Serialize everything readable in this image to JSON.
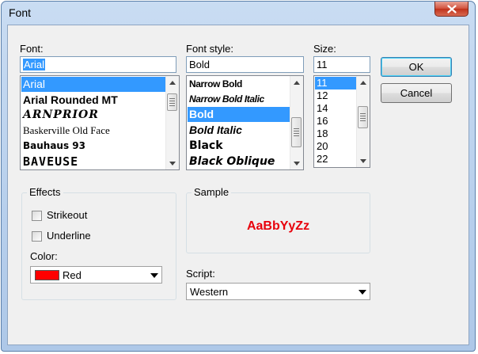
{
  "dialog": {
    "title": "Font",
    "ok_label": "OK",
    "cancel_label": "Cancel"
  },
  "font": {
    "label": "Font:",
    "value": "Arial",
    "items": [
      {
        "label": "Arial",
        "selected": true
      },
      {
        "label": "Arial Rounded MT",
        "selected": false
      },
      {
        "label": "ARNPRIOR",
        "selected": false
      },
      {
        "label": "Baskerville Old Face",
        "selected": false
      },
      {
        "label": "Bauhaus 93",
        "selected": false
      },
      {
        "label": "BAVEUSE",
        "selected": false
      }
    ]
  },
  "style": {
    "label": "Font style:",
    "value": "Bold",
    "items": [
      {
        "label": "Narrow Bold",
        "selected": false
      },
      {
        "label": "Narrow Bold Italic",
        "selected": false
      },
      {
        "label": "Bold",
        "selected": true
      },
      {
        "label": "Bold Italic",
        "selected": false
      },
      {
        "label": "Black",
        "selected": false
      },
      {
        "label": "Black Oblique",
        "selected": false
      }
    ]
  },
  "size": {
    "label": "Size:",
    "value": "11",
    "items": [
      {
        "label": "11",
        "selected": true
      },
      {
        "label": "12",
        "selected": false
      },
      {
        "label": "14",
        "selected": false
      },
      {
        "label": "16",
        "selected": false
      },
      {
        "label": "18",
        "selected": false
      },
      {
        "label": "20",
        "selected": false
      },
      {
        "label": "22",
        "selected": false
      }
    ]
  },
  "effects": {
    "title": "Effects",
    "strikeout_label": "Strikeout",
    "strikeout_checked": false,
    "underline_label": "Underline",
    "underline_checked": false,
    "color_label": "Color:",
    "color_value": "Red",
    "color_hex": "#ff0000"
  },
  "sample": {
    "title": "Sample",
    "text": "AaBbYyZz",
    "color": "#e8000b"
  },
  "script": {
    "label": "Script:",
    "value": "Western"
  }
}
